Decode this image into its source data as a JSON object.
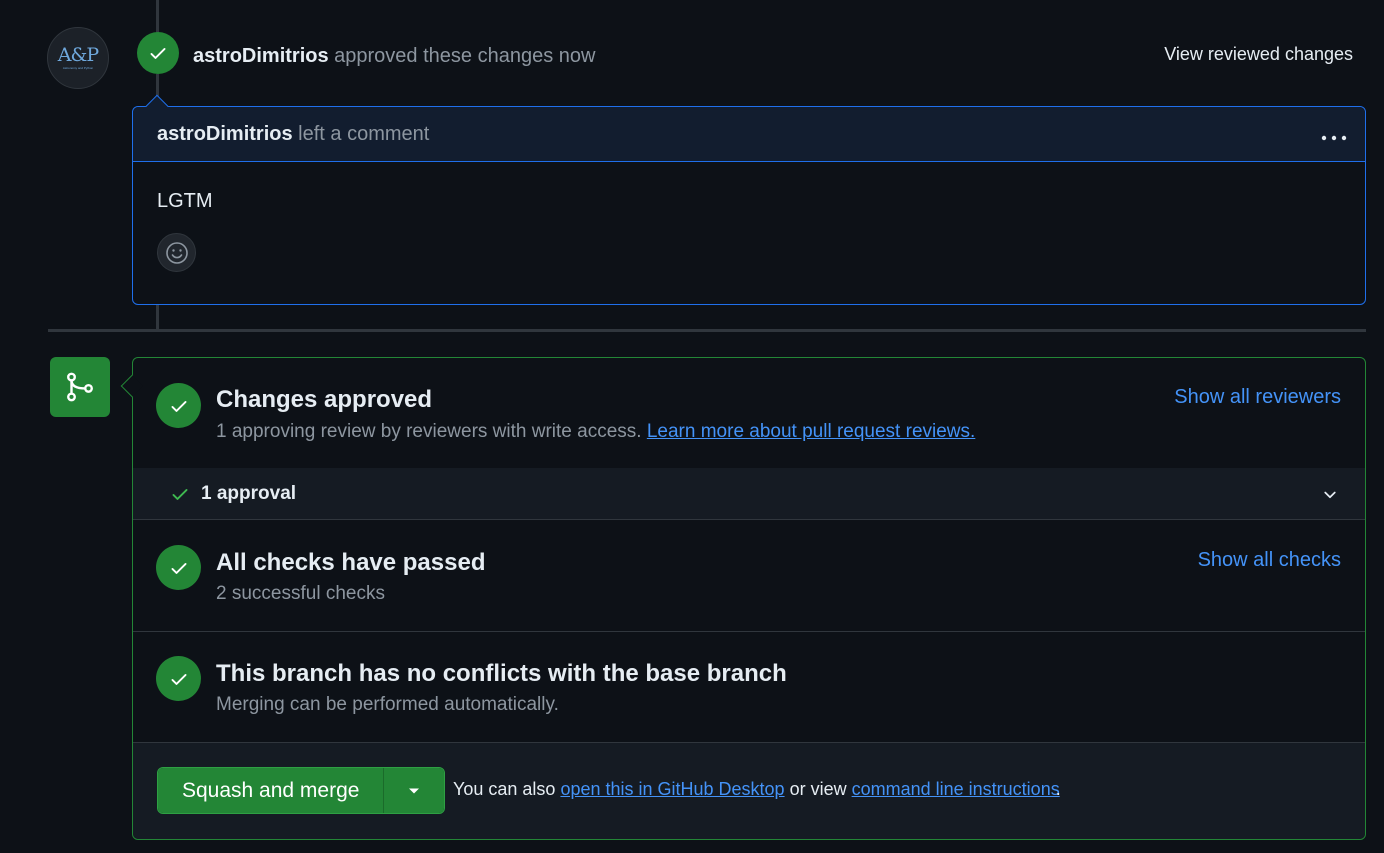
{
  "review_event": {
    "author": "astroDimitrios",
    "action_text": "approved these changes now",
    "view_link": "View reviewed changes",
    "avatar": {
      "logo_text": "A&P",
      "logo_subtext": "Astronomy and Python",
      "color": "#6fa8dc"
    }
  },
  "comment": {
    "author": "astroDimitrios",
    "action_text": "left a comment",
    "menu_icon": "kebab-horizontal-icon",
    "body": "LGTM",
    "reaction_icon": "smiley-icon"
  },
  "merge_box": {
    "approved": {
      "title": "Changes approved",
      "subtitle": "1 approving review by reviewers with write access.",
      "learn_more": "Learn more about pull request reviews.",
      "show_reviewers": "Show all reviewers"
    },
    "approval_row": {
      "label": "1 approval"
    },
    "checks": {
      "title": "All checks have passed",
      "subtitle": "2 successful checks",
      "show_checks": "Show all checks"
    },
    "conflicts": {
      "title": "This branch has no conflicts with the base branch",
      "subtitle": "Merging can be performed automatically."
    },
    "footer": {
      "merge_button": "Squash and merge",
      "text_prefix": "You can also",
      "desktop_link": "open this in GitHub Desktop",
      "text_middle": "or view",
      "cli_link": "command line instructions",
      "text_suffix": "."
    }
  },
  "colors": {
    "background": "#0d1117",
    "success": "#238636",
    "link": "#4493f8",
    "muted": "#8d96a0",
    "comment_border": "#1f6feb"
  }
}
